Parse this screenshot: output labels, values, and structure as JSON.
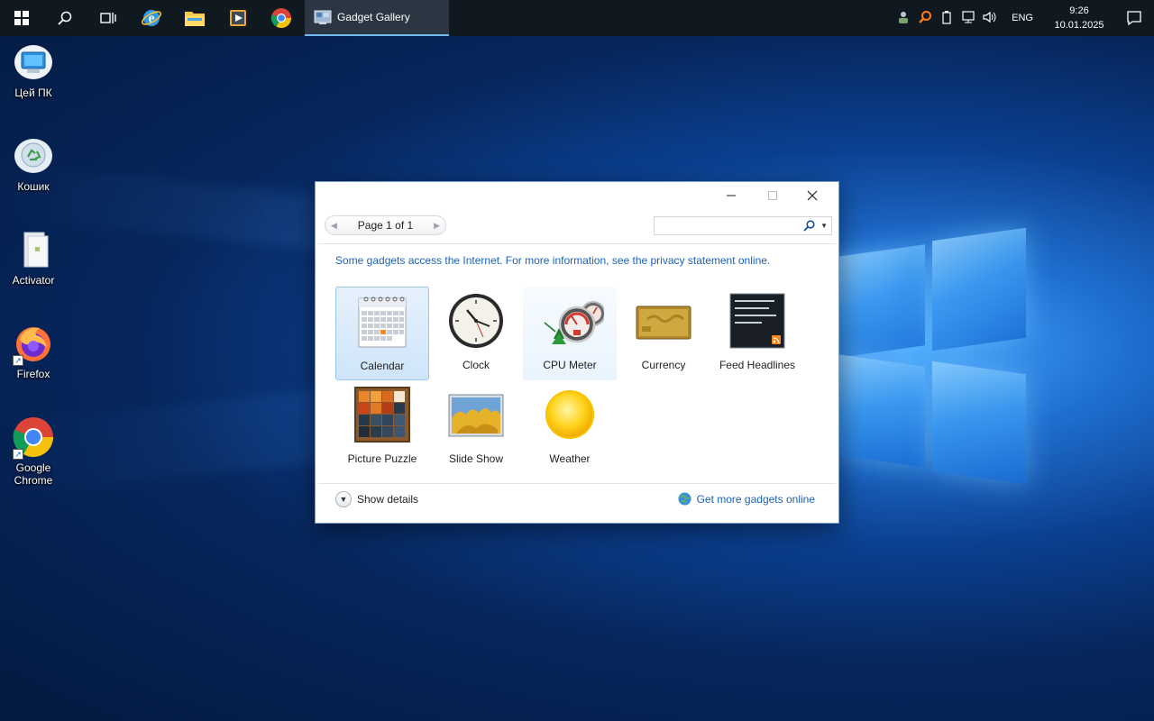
{
  "taskbar": {
    "active_window": "Gadget Gallery",
    "tray": {
      "language": "ENG",
      "time": "9:26",
      "date": "10.01.2025"
    }
  },
  "desktop": {
    "icons": [
      {
        "label": "Цей ПК"
      },
      {
        "label": "Кошик"
      },
      {
        "label": "Activator"
      },
      {
        "label": "Firefox"
      },
      {
        "label": "Google Chrome"
      }
    ]
  },
  "window": {
    "pager": {
      "label": "Page 1 of 1"
    },
    "search": {
      "value": "",
      "placeholder": ""
    },
    "notice": "Some gadgets access the Internet.  For more information, see the privacy statement online.",
    "gadgets": [
      {
        "label": "Calendar",
        "state": "selected"
      },
      {
        "label": "Clock"
      },
      {
        "label": "CPU Meter",
        "state": "hover"
      },
      {
        "label": "Currency"
      },
      {
        "label": "Feed Headlines"
      },
      {
        "label": "Picture Puzzle"
      },
      {
        "label": "Slide Show"
      },
      {
        "label": "Weather"
      }
    ],
    "show_details": "Show details",
    "get_more": "Get more gadgets online"
  },
  "colors": {
    "accent_link": "#1c63b7",
    "taskbar_bg": "#101820",
    "selection": "#cfe5fa"
  }
}
